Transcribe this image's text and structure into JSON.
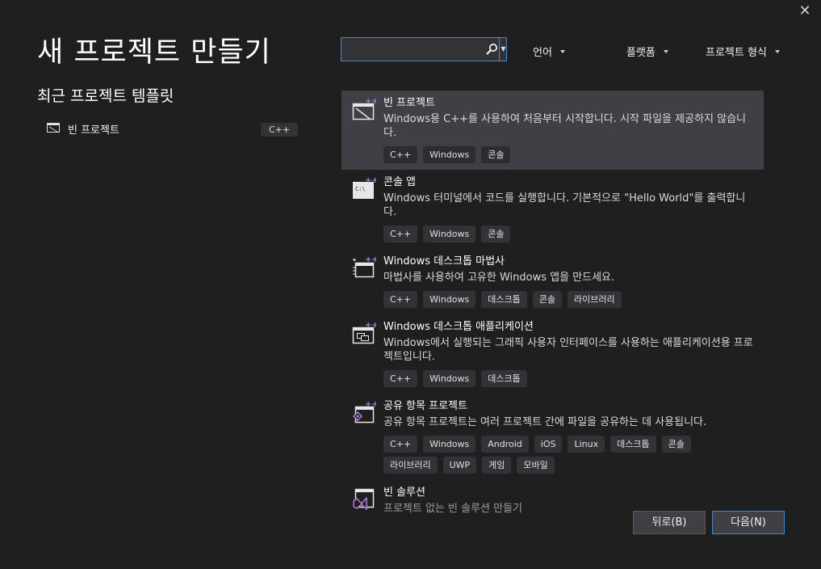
{
  "window": {
    "close_label": "✕"
  },
  "header": {
    "title": "새 프로젝트 만들기"
  },
  "recent": {
    "title": "최근 프로젝트 템플릿",
    "items": [
      {
        "label": "빈 프로젝트",
        "tag": "C++"
      }
    ]
  },
  "search": {
    "value": "",
    "placeholder": ""
  },
  "filters": {
    "language": "언어",
    "platform": "플랫폼",
    "project_type": "프로젝트 형식"
  },
  "templates": [
    {
      "name": "빈 프로젝트",
      "description": "Windows용 C++를 사용하여 처음부터 시작합니다. 시작 파일을 제공하지 않습니다.",
      "tags": [
        "C++",
        "Windows",
        "콘솔"
      ]
    },
    {
      "name": "콘솔 앱",
      "description": "Windows 터미널에서 코드를 실행합니다. 기본적으로 \"Hello World\"를 출력합니다.",
      "tags": [
        "C++",
        "Windows",
        "콘솔"
      ]
    },
    {
      "name": "Windows 데스크톱 마법사",
      "description": "마법사를 사용하여 고유한 Windows 앱을 만드세요.",
      "tags": [
        "C++",
        "Windows",
        "데스크톱",
        "콘솔",
        "라이브러리"
      ]
    },
    {
      "name": "Windows 데스크톱 애플리케이션",
      "description": "Windows에서 실행되는 그래픽 사용자 인터페이스를 사용하는 애플리케이션용 프로젝트입니다.",
      "tags": [
        "C++",
        "Windows",
        "데스크톱"
      ]
    },
    {
      "name": "공유 항목 프로젝트",
      "description": "공유 항목 프로젝트는 여러 프로젝트 간에 파일을 공유하는 데 사용됩니다.",
      "tags": [
        "C++",
        "Windows",
        "Android",
        "iOS",
        "Linux",
        "데스크톱",
        "콘솔",
        "라이브러리",
        "UWP",
        "게임",
        "모바일"
      ]
    },
    {
      "name": "빈 솔루션",
      "description": "프로젝트 없는 빈 솔루션 만들기",
      "tags": []
    }
  ],
  "footer": {
    "back_label": "뒤로(B)",
    "next_label": "다음(N)"
  },
  "colors": {
    "background": "#1f1f1f",
    "selected": "#3f3f46",
    "accent": "#3e8ad2",
    "plus": "#b180d7"
  }
}
